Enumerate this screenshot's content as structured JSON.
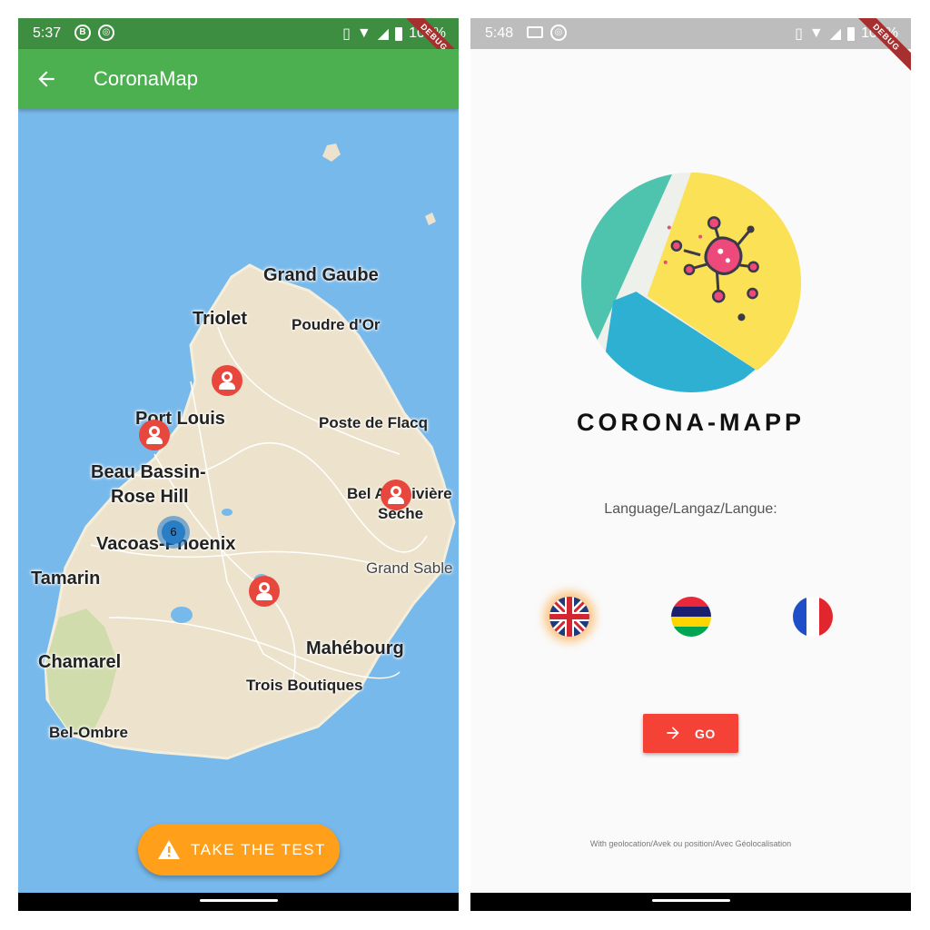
{
  "left": {
    "status_bar": {
      "time": "5:37",
      "icons": [
        "b-badge-icon",
        "sync-icon"
      ],
      "battery_percent": "100%"
    },
    "debug_banner": "DEBUG",
    "app_bar": {
      "title": "CoronaMap",
      "back_icon": "arrow-left-icon"
    },
    "map": {
      "places": {
        "grand_gaube": "Grand Gaube",
        "triolet": "Triolet",
        "poudre_dor": "Poudre d'Or",
        "port_louis": "Port Louis",
        "poste_de_flacq": "Poste de Flacq",
        "beau_bassin_1": "Beau Bassin-",
        "beau_bassin_2": "Rose Hill",
        "bel_air_1": "Bel Air Rivière",
        "bel_air_2": "Sèche",
        "vacoas": "Vacoas-Phoenix",
        "tamarin": "Tamarin",
        "grand_sable": "Grand Sable",
        "chamarel": "Chamarel",
        "mahebourg": "Mahébourg",
        "trois_boutiques": "Trois Boutiques",
        "bel_ombre": "Bel-Ombre"
      },
      "cluster_count": "6"
    },
    "fab": {
      "label": "TAKE THE TEST",
      "icon": "warning-icon",
      "color": "#FF9F1A"
    }
  },
  "right": {
    "status_bar": {
      "time": "5:48",
      "icons": [
        "laptop-icon",
        "sync-icon"
      ],
      "battery_percent": "100%"
    },
    "debug_banner": "DEBUG",
    "brand": "CORONA-MAPP",
    "language_label": "Language/Langaz/Langue:",
    "languages": [
      {
        "name": "english",
        "flag": "uk-flag-icon",
        "selected": true
      },
      {
        "name": "kreol",
        "flag": "mauritius-flag-icon",
        "selected": false
      },
      {
        "name": "french",
        "flag": "france-flag-icon",
        "selected": false
      }
    ],
    "go_button": {
      "label": "GO",
      "icon": "arrow-right-icon",
      "color": "#F44336"
    },
    "footnote": "With geolocation/Avek ou position/Avec Géolocalisation"
  }
}
